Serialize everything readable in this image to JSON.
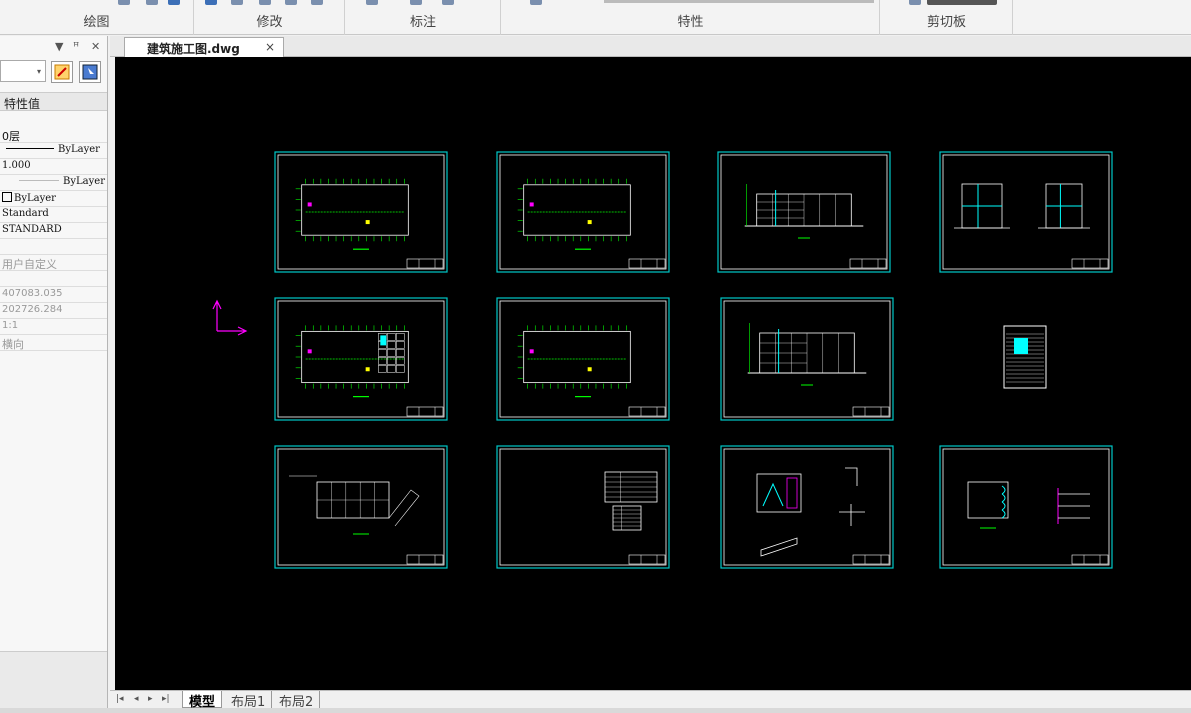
{
  "ribbon": {
    "groups": [
      {
        "label": "绘图"
      },
      {
        "label": "修改"
      },
      {
        "label": "标注"
      },
      {
        "label": "特性"
      },
      {
        "label": "剪切板"
      }
    ]
  },
  "properties_panel": {
    "header_icons": [
      "dropdown-arrow-icon",
      "pin-icon",
      "close-icon"
    ],
    "column_header": "特性值",
    "rows": [
      {
        "value": "0层"
      },
      {
        "value": "ByLayer"
      },
      {
        "value": "1.000"
      },
      {
        "value": "ByLayer"
      },
      {
        "value": "ByLayer"
      },
      {
        "value": "Standard"
      },
      {
        "value": "STANDARD"
      },
      {
        "value": "用户自定义"
      },
      {
        "value": "407083.035"
      },
      {
        "value": "202726.284"
      },
      {
        "value": "1:1"
      },
      {
        "value": "横向"
      }
    ]
  },
  "document_tab": {
    "name": "建筑施工图.dwg",
    "close": "×"
  },
  "layout_tabs": [
    "模型",
    "布局1",
    "布局2"
  ],
  "colors": {
    "canvas": "#000000",
    "frame": "#00c8c8",
    "lines": "#ffffff",
    "green": "#00ff00",
    "magenta": "#ff00ff",
    "yellow": "#ffff00",
    "cyan": "#00ffff"
  }
}
